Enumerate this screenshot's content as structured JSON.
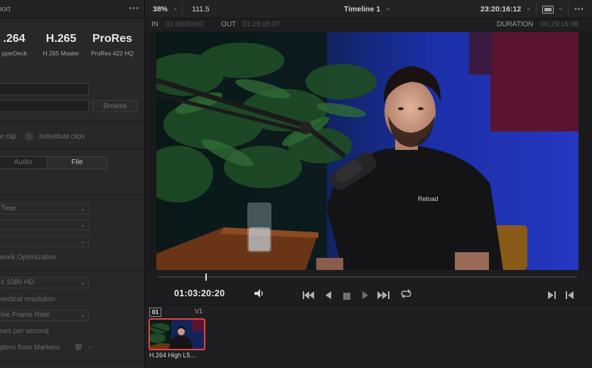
{
  "left_panel": {
    "header_title": "port",
    "more_label": "•••",
    "presets": [
      {
        "title": ".264",
        "subtitle": "yperDeck"
      },
      {
        "title": "H.265",
        "subtitle": "H.265 Master"
      },
      {
        "title": "ProRes",
        "subtitle": "ProRes 422 HQ"
      }
    ],
    "browse_label": "Browse",
    "single_clip_label": "e clip",
    "individual_clips_label": "individual clips",
    "tabs": [
      "Audio",
      "File"
    ],
    "dropdowns": [
      {
        "value": "Time"
      },
      {
        "value": ""
      },
      {
        "value": ""
      }
    ],
    "network_optimization_label": "work Optimization",
    "resolution_value": "x 1080 HD",
    "vertical_resolution_label": "vertical resolution",
    "frame_rate_value": "ine Frame Rate",
    "frames_per_second_label": "nes per second",
    "chapters_label": "pters from Markers"
  },
  "topbar": {
    "zoom": "38%",
    "framerate": "111.5",
    "timeline_name": "Timeline 1",
    "timecode": "23:20:16:12",
    "more_label": "•••"
  },
  "inout": {
    "in_label": "IN",
    "in_tc": "01:00:00:00",
    "out_label": "OUT",
    "out_tc": "01:29:16:07",
    "duration_label": "DURATION",
    "duration_tc": "00:29:16:08"
  },
  "transport": {
    "timecode": "01:03:20:20",
    "playhead_fraction": 0.115
  },
  "timeline": {
    "clip_number": "01",
    "track_label": "V1",
    "clip_name": "H.264 High L5..."
  },
  "video": {
    "shirt_text": "Reload"
  },
  "colors": {
    "accent_red": "#e04545",
    "panel_bg": "#28282b",
    "topbar_bg": "#232326"
  }
}
